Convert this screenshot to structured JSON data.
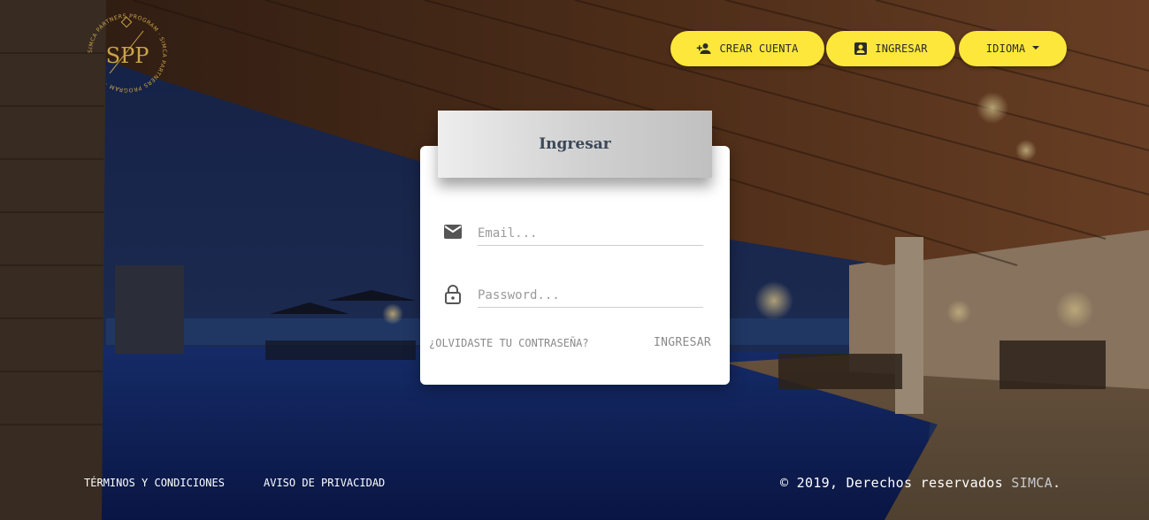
{
  "brand": {
    "logo_initials": "SPP",
    "logo_ring_text": "SIMCA PARTNERS PROGRAM · SIMCA PARTNERS PROGRAM ·",
    "accent": "#fde73a",
    "gold": "#c9a44a"
  },
  "nav": {
    "crear_cuenta": "CREAR CUENTA",
    "ingresar": "INGRESAR",
    "idioma": "IDIOMA"
  },
  "login": {
    "title": "Ingresar",
    "email_placeholder": "Email...",
    "password_placeholder": "Password...",
    "forgot": "¿OLVIDASTE TU CONTRASEÑA?",
    "submit": "INGRESAR"
  },
  "footer": {
    "terms": "TÉRMINOS Y CONDICIONES",
    "privacy": "AVISO DE PRIVACIDAD",
    "copyright_prefix": "© 2019, Derechos reservados",
    "copyright_brand": "SIMCA",
    "copyright_suffix": "."
  },
  "icons": {
    "crear": "person-add-icon",
    "ingresar": "account-box-icon",
    "idioma": "caret-down-icon",
    "email": "mail-icon",
    "password": "lock-icon"
  }
}
